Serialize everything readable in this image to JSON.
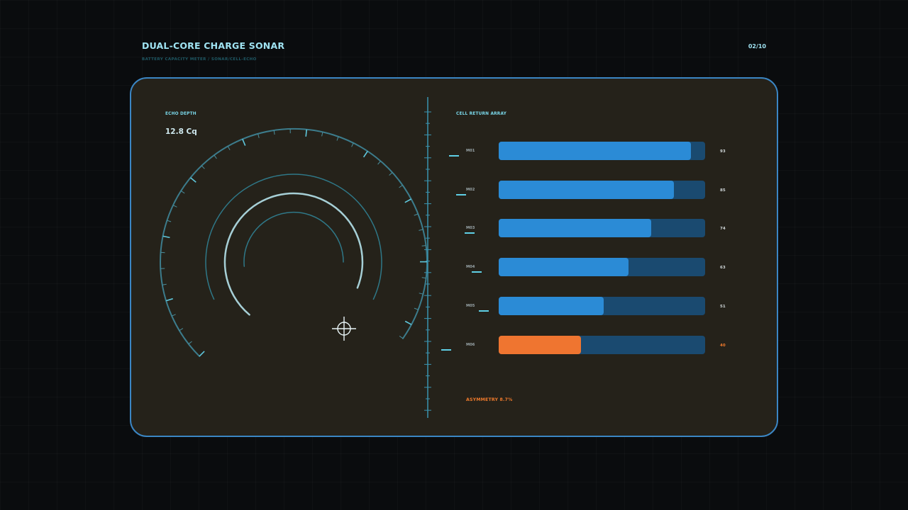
{
  "header": {
    "title": "DUAL-CORE CHARGE SONAR",
    "subtitle": "BATTERY CAPACITY METER / SONAR/CELL-ECHO",
    "page": "02/10"
  },
  "left": {
    "label": "ECHO DEPTH",
    "value": "12.8 Cq"
  },
  "right": {
    "label": "CELL RETURN ARRAY",
    "cells": [
      {
        "name": "M01",
        "value": 93,
        "display": "93",
        "warn": false
      },
      {
        "name": "M02",
        "value": 85,
        "display": "85",
        "warn": false
      },
      {
        "name": "M03",
        "value": 74,
        "display": "74",
        "warn": false
      },
      {
        "name": "M04",
        "value": 63,
        "display": "63",
        "warn": false
      },
      {
        "name": "M05",
        "value": 51,
        "display": "51",
        "warn": false
      },
      {
        "name": "M06",
        "value": 40,
        "display": "40",
        "warn": true
      }
    ],
    "asymmetry": "ASYMMETRY 8.7%"
  },
  "colors": {
    "accent": "#7ad8ea",
    "bar": "#2b8bd6",
    "track": "#1a4a70",
    "warn": "#ef7530",
    "panel": "#25221a",
    "border": "#3b86c4"
  }
}
